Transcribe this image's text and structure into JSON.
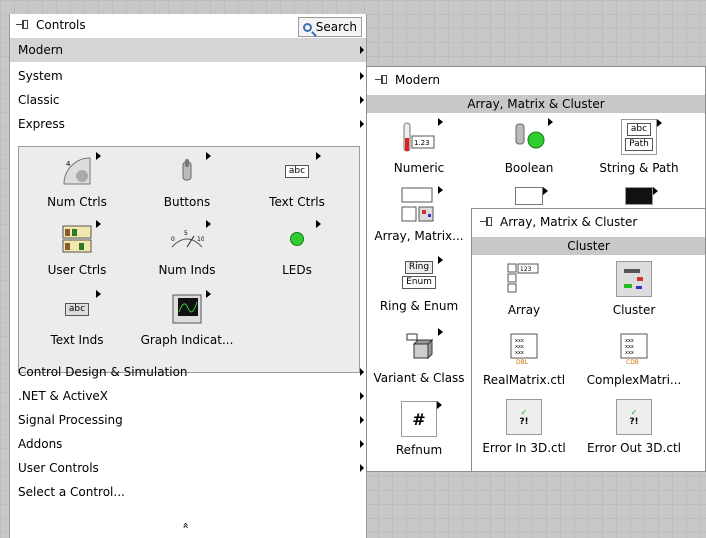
{
  "main_palette": {
    "title": "Controls",
    "search_label": "Search",
    "items": [
      {
        "label": "Modern",
        "has_submenu": true,
        "selected": true
      },
      {
        "label": "System",
        "has_submenu": true
      },
      {
        "label": "Classic",
        "has_submenu": true
      },
      {
        "label": "Express",
        "has_submenu": true
      }
    ],
    "express_items": [
      {
        "label": "Num Ctrls",
        "icon": "num-ctrls-icon"
      },
      {
        "label": "Buttons",
        "icon": "buttons-icon"
      },
      {
        "label": "Text Ctrls",
        "icon": "text-ctrls-icon",
        "glyph": "abc"
      },
      {
        "label": "User Ctrls",
        "icon": "user-ctrls-icon"
      },
      {
        "label": "Num Inds",
        "icon": "num-inds-icon"
      },
      {
        "label": "LEDs",
        "icon": "leds-icon"
      },
      {
        "label": "Text Inds",
        "icon": "text-inds-icon",
        "glyph": "abc"
      },
      {
        "label": "Graph Indicat...",
        "icon": "graph-indicators-icon"
      }
    ],
    "lower_items": [
      {
        "label": "Control Design & Simulation",
        "has_submenu": true
      },
      {
        "label": ".NET & ActiveX",
        "has_submenu": true
      },
      {
        "label": "Signal Processing",
        "has_submenu": true
      },
      {
        "label": "Addons",
        "has_submenu": true
      },
      {
        "label": "User Controls",
        "has_submenu": true
      },
      {
        "label": "Select a Control...",
        "has_submenu": false
      }
    ],
    "collapse_glyph": "«"
  },
  "modern_palette": {
    "title": "Modern",
    "category": "Array, Matrix & Cluster",
    "items": [
      {
        "label": "Numeric",
        "icon": "numeric-icon",
        "glyph": "1.23"
      },
      {
        "label": "Boolean",
        "icon": "boolean-icon"
      },
      {
        "label": "String & Path",
        "icon": "string-path-icon",
        "glyph": "abc",
        "glyph2": "Path"
      },
      {
        "label": "Array, Matrix...",
        "icon": "array-matrix-icon"
      },
      {
        "label": "Ring & Enum",
        "icon": "ring-enum-icon",
        "glyph": "Ring",
        "glyph2": "Enum"
      },
      {
        "label": "Variant & Class",
        "icon": "variant-class-icon"
      },
      {
        "label": "Refnum",
        "icon": "refnum-icon",
        "glyph": "#"
      }
    ]
  },
  "array_palette": {
    "title": "Array, Matrix & Cluster",
    "category": "Cluster",
    "items": [
      {
        "label": "Array",
        "icon": "array-icon",
        "glyph": "123"
      },
      {
        "label": "Cluster",
        "icon": "cluster-icon"
      },
      {
        "label": "RealMatrix.ctl",
        "icon": "real-matrix-icon",
        "glyph": "DBL"
      },
      {
        "label": "ComplexMatri...",
        "icon": "complex-matrix-icon",
        "glyph": "CDB"
      },
      {
        "label": "Error In 3D.ctl",
        "icon": "error-in-icon",
        "glyph": "?!"
      },
      {
        "label": "Error Out 3D.ctl",
        "icon": "error-out-icon",
        "glyph": "?!"
      }
    ]
  },
  "colors": {
    "selected_row": "#d5d5d5",
    "category_bar": "#c8c8c8",
    "led_green": "#2ecc2e"
  }
}
